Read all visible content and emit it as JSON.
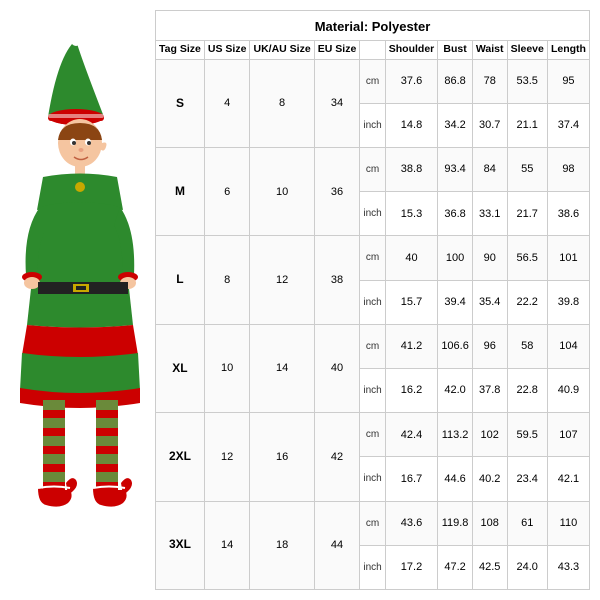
{
  "material": "Material: Polyester",
  "headers": {
    "tag_size": "Tag Size",
    "us_size": "US Size",
    "ukau_size": "UK/AU Size",
    "eu_size": "EU Size",
    "unit": "",
    "shoulder": "Shoulder",
    "bust": "Bust",
    "waist": "Waist",
    "sleeve": "Sleeve",
    "length": "Length"
  },
  "rows": [
    {
      "tag": "S",
      "us": "4",
      "ukau": "8",
      "eu": "34",
      "cm": [
        "37.6",
        "86.8",
        "78",
        "53.5",
        "95"
      ],
      "inch": [
        "14.8",
        "34.2",
        "30.7",
        "21.1",
        "37.4"
      ]
    },
    {
      "tag": "M",
      "us": "6",
      "ukau": "10",
      "eu": "36",
      "cm": [
        "38.8",
        "93.4",
        "84",
        "55",
        "98"
      ],
      "inch": [
        "15.3",
        "36.8",
        "33.1",
        "21.7",
        "38.6"
      ]
    },
    {
      "tag": "L",
      "us": "8",
      "ukau": "12",
      "eu": "38",
      "cm": [
        "40",
        "100",
        "90",
        "56.5",
        "101"
      ],
      "inch": [
        "15.7",
        "39.4",
        "35.4",
        "22.2",
        "39.8"
      ]
    },
    {
      "tag": "XL",
      "us": "10",
      "ukau": "14",
      "eu": "40",
      "cm": [
        "41.2",
        "106.6",
        "96",
        "58",
        "104"
      ],
      "inch": [
        "16.2",
        "42.0",
        "37.8",
        "22.8",
        "40.9"
      ]
    },
    {
      "tag": "2XL",
      "us": "12",
      "ukau": "16",
      "eu": "42",
      "cm": [
        "42.4",
        "113.2",
        "102",
        "59.5",
        "107"
      ],
      "inch": [
        "16.7",
        "44.6",
        "40.2",
        "23.4",
        "42.1"
      ]
    },
    {
      "tag": "3XL",
      "us": "14",
      "ukau": "18",
      "eu": "44",
      "cm": [
        "43.6",
        "119.8",
        "108",
        "61",
        "110"
      ],
      "inch": [
        "17.2",
        "47.2",
        "42.5",
        "24.0",
        "43.3"
      ]
    }
  ],
  "units": {
    "cm": "cm",
    "inch": "inch"
  }
}
